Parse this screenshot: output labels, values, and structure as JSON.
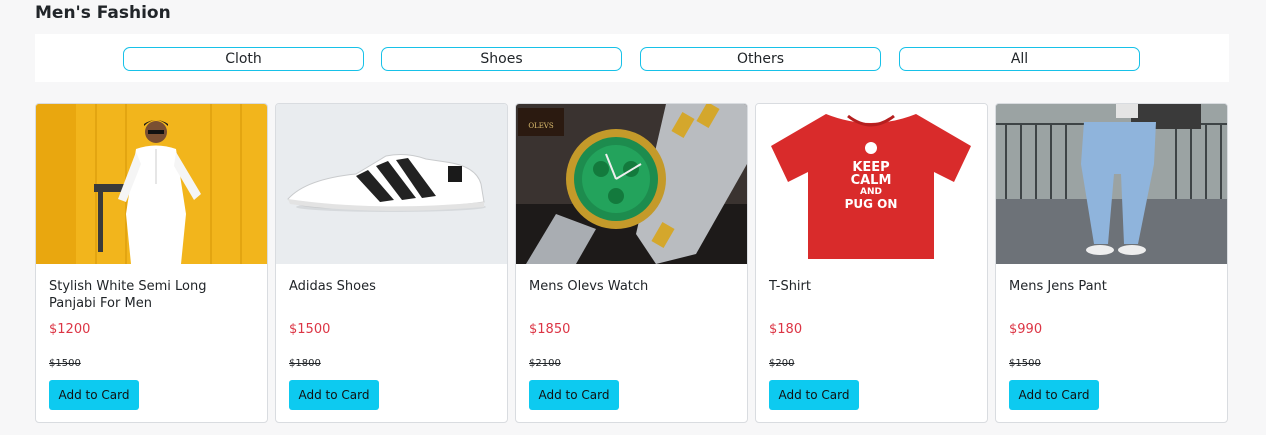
{
  "page": {
    "title": "Men's Fashion"
  },
  "filters": [
    {
      "label": "Cloth"
    },
    {
      "label": "Shoes"
    },
    {
      "label": "Others"
    },
    {
      "label": "All"
    }
  ],
  "products": [
    {
      "name": "Stylish White Semi Long Panjabi For Men",
      "price": "$1200",
      "old_price": "$1500",
      "button": "Add to Card",
      "image": "panjabi-photo"
    },
    {
      "name": "Adidas Shoes",
      "price": "$1500",
      "old_price": "$1800",
      "button": "Add to Card",
      "image": "sneaker-photo"
    },
    {
      "name": "Mens Olevs Watch",
      "price": "$1850",
      "old_price": "$2100",
      "button": "Add to Card",
      "image": "watch-photo",
      "image_badge": "OLEVS"
    },
    {
      "name": "T-Shirt",
      "price": "$180",
      "old_price": "$200",
      "button": "Add to Card",
      "image": "tshirt-photo",
      "shirt_text": [
        "KEEP",
        "CALM",
        "AND",
        "PUG ON"
      ]
    },
    {
      "name": "Mens Jens Pant",
      "price": "$990",
      "old_price": "$1500",
      "button": "Add to Card",
      "image": "jeans-photo"
    }
  ],
  "colors": {
    "accent": "#0dcaf0",
    "filter_border": "#17c1e8",
    "price": "#dc3545"
  }
}
